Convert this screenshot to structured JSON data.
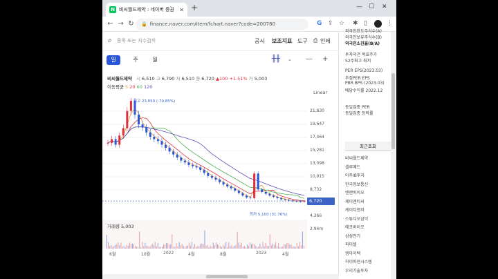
{
  "browser": {
    "tab_title": "비씨월드제약 : 네이버 증권",
    "tab_close": "✕",
    "new_tab": "+",
    "url": "finance.naver.com/item/fchart.naver?code=200780"
  },
  "header": {
    "search_placeholder": "종목 또는 지수검색",
    "menu": [
      "공시",
      "보조지표",
      "도구",
      "인쇄"
    ]
  },
  "periods": [
    "일",
    "주",
    "월"
  ],
  "active_period": "일",
  "stock": {
    "name": "비씨월드제약",
    "open_label": "시",
    "open": "6,510",
    "high_label": "고",
    "high": "6,790",
    "low_label": "저",
    "low": "6,510",
    "close_label": "종",
    "close": "6,720",
    "change": "▲100 +1.51%",
    "volume_label": "거",
    "volume": "5,003"
  },
  "ma": {
    "label": "이동평균",
    "m5": "5",
    "m20": "20",
    "m60": "60",
    "m120": "120"
  },
  "scale_mode": "Linear",
  "chart_data": {
    "type": "line",
    "x": [
      "6월",
      "10월",
      "2022",
      "4월",
      "8월",
      "2023",
      "4월"
    ],
    "y_ticks": [
      "21,830",
      "19,647",
      "17,464",
      "15,281",
      "13,098",
      "10,915",
      "8,732",
      "4,366"
    ],
    "current_price": "6,720",
    "max_annotation": "최고 23,050 (-70.85%)",
    "min_annotation": "최저 5,100 (31.76%)",
    "volume_label": "거래량 5,003",
    "volume_axis": "2.94m",
    "series": [
      {
        "name": "종",
        "values": [
          16200,
          16800,
          15900,
          17400,
          18600,
          21400,
          23050,
          20800,
          19200,
          18700,
          17900,
          17200,
          16800,
          16500,
          15900,
          15400,
          14800,
          14300,
          13800,
          13300,
          13000,
          12600,
          12400,
          12200,
          11800,
          11300,
          10800,
          10500,
          10200,
          9800,
          9400,
          9100,
          8800,
          8400,
          8000,
          7600,
          7300,
          7200,
          11200,
          8600,
          8200,
          7900,
          7600,
          7400,
          7200,
          7000,
          6900,
          6800,
          6750,
          6700,
          6650,
          6720
        ]
      }
    ],
    "ma_series": [
      {
        "name": "5",
        "color": "#e79d2e"
      },
      {
        "name": "20",
        "color": "#e0303b"
      },
      {
        "name": "60",
        "color": "#4cae4c"
      },
      {
        "name": "120",
        "color": "#5b4bb8"
      }
    ]
  },
  "side_panel": {
    "lines": [
      "외국인한도주식수(A)",
      "외국인보유주식수(B)",
      "외국인소진율(B/A)",
      "투자의견 목표주가",
      "52주최고 최저",
      "PER EPS(2023.03)",
      "추정PER EPS",
      "PBR BPS (2023.03)",
      "배당수익률 2022.12",
      "동일업종 PER",
      "동일업종 등락률"
    ],
    "recent_title": "최근조회",
    "recent_items": [
      "비씨월드제약",
      "셀루메드",
      "아주IB투자",
      "한국정보통신",
      "엔젠바이오",
      "제이엔티씨",
      "케이티앤지",
      "스튜디오삼익",
      "에코바이오",
      "삼성전기",
      "파미셀",
      "엠아이텍",
      "하이비젼시스템",
      "우리기술투자"
    ]
  }
}
